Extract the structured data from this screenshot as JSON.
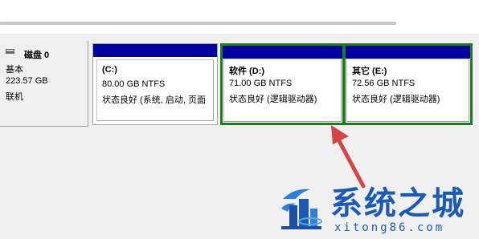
{
  "disk": {
    "name": "磁盘 0",
    "type": "基本",
    "size": "223.57 GB",
    "state": "联机"
  },
  "partitions": [
    {
      "title": "(C:)",
      "size": "80.00 GB NTFS",
      "status": "状态良好 (系统, 启动, 页面"
    },
    {
      "title": "软件  (D:)",
      "size": "71.00 GB NTFS",
      "status": "状态良好 (逻辑驱动器)"
    },
    {
      "title": "其它  (E:)",
      "size": "72.56 GB NTFS",
      "status": "状态良好 (逻辑驱动器)"
    }
  ],
  "colors": {
    "partition_bar": "#00009e",
    "selection_border": "#1a7f1a",
    "arrow": "#d64545",
    "watermark": "#1c5bb5"
  },
  "watermark": {
    "title": "系统之城",
    "url": "xitong86.com"
  }
}
